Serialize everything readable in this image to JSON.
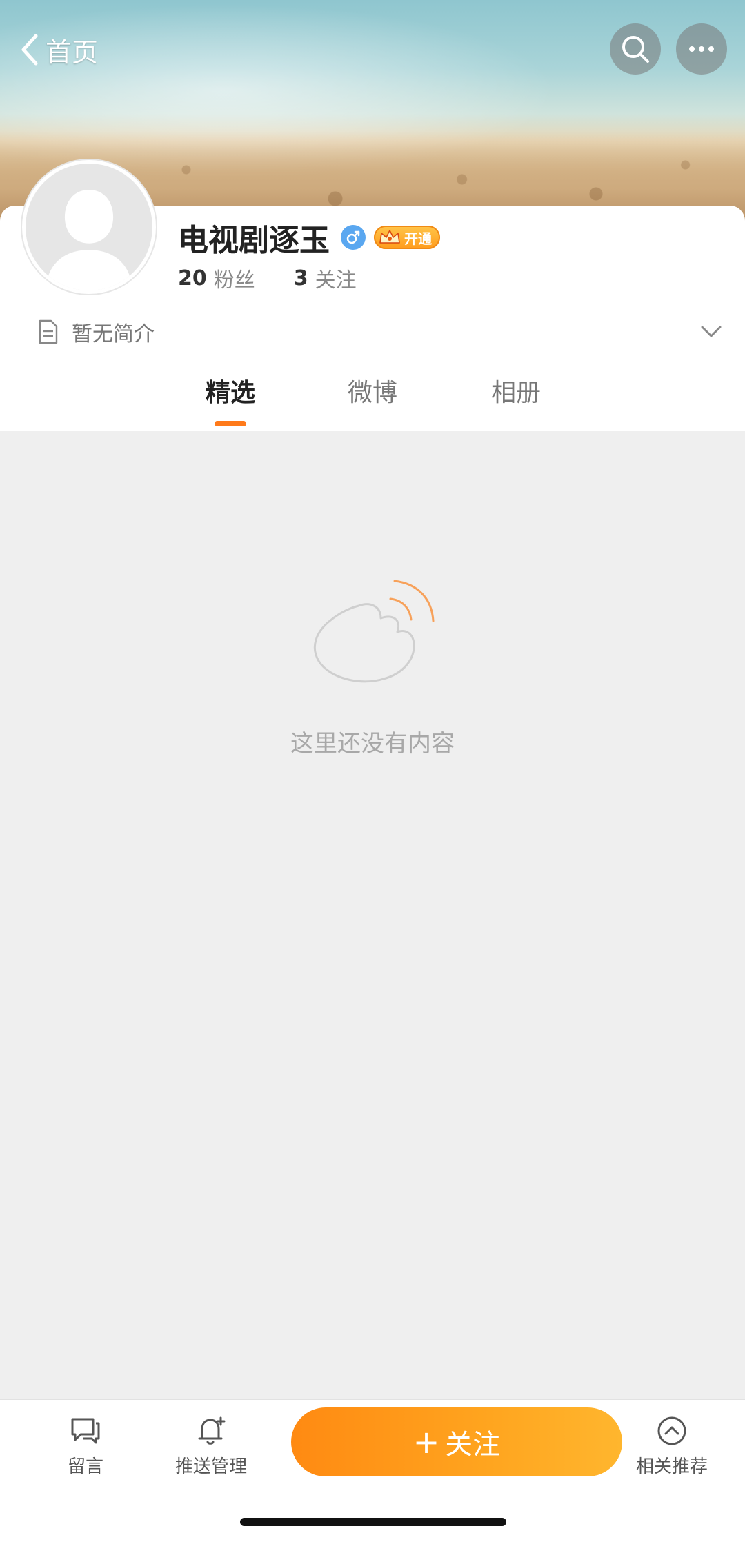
{
  "header": {
    "back_label": "首页",
    "search_icon": "search-icon",
    "more_icon": "more-icon"
  },
  "profile": {
    "name": "电视剧逐玉",
    "gender_icon": "male-icon",
    "vip_label": "开通",
    "followers_count": "20",
    "followers_label": "粉丝",
    "following_count": "3",
    "following_label": "关注",
    "bio": "暂无简介"
  },
  "tabs": [
    {
      "label": "精选",
      "active": true
    },
    {
      "label": "微博",
      "active": false
    },
    {
      "label": "相册",
      "active": false
    }
  ],
  "empty_state": {
    "text": "这里还没有内容"
  },
  "bottom_bar": {
    "message_label": "留言",
    "push_label": "推送管理",
    "follow_plus": "+",
    "follow_label": "关注",
    "related_label": "相关推荐"
  },
  "colors": {
    "accent": "#ff7a1a",
    "follow_button": "#ff9a1a",
    "gender_badge": "#5aa7f0"
  }
}
